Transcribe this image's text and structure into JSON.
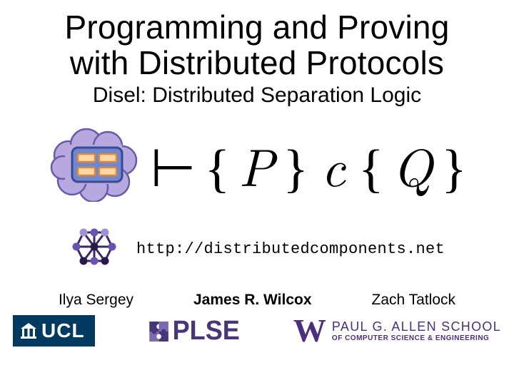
{
  "title_line1": "Programming and Proving",
  "title_line2": "with Distributed Protocols",
  "subtitle": "Disel: Distributed Separation Logic",
  "formula": {
    "turnstile": "⊢",
    "lbr1": "{",
    "P": "P",
    "rbr1": "}",
    "c": "c",
    "lbr2": "{",
    "Q": "Q",
    "rbr2": "}"
  },
  "url": "http://distributedcomponents.net",
  "authors": {
    "a1": "Ilya Sergey",
    "a2": "James R. Wilcox",
    "a3": "Zach Tatlock"
  },
  "logos": {
    "ucl_text": "UCL",
    "plse_text": "PLSE",
    "allen_W": "W",
    "allen_l1": "PAUL G. ALLEN SCHOOL",
    "allen_l2": "OF COMPUTER SCIENCE & ENGINEERING"
  }
}
